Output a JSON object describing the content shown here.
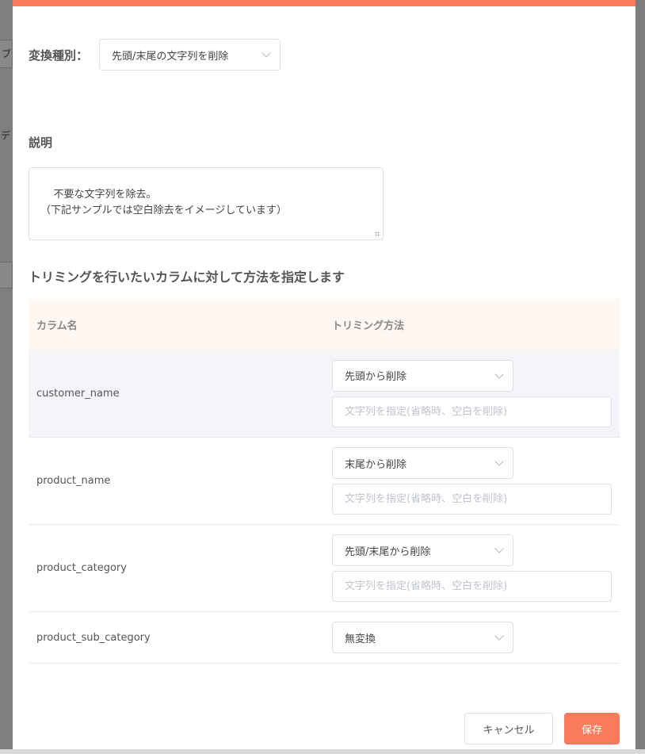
{
  "background": {
    "fragments": [
      "ブ",
      "デ"
    ]
  },
  "conversion": {
    "label": "変換種別：",
    "selected": "先頭/末尾の文字列を削除"
  },
  "description": {
    "title": "説明",
    "text": "不要な文字列を除去。\n（下記サンプルでは空白除去をイメージしています）"
  },
  "section_title": "トリミングを行いたいカラムに対して方法を指定します",
  "table": {
    "headers": [
      "カラム名",
      "トリミング方法"
    ],
    "rows": [
      {
        "name": "customer_name",
        "method": "先頭から削除",
        "placeholder": "文字列を指定(省略時、空白を削除)"
      },
      {
        "name": "product_name",
        "method": "末尾から削除",
        "placeholder": "文字列を指定(省略時、空白を削除)"
      },
      {
        "name": "product_category",
        "method": "先頭/末尾から削除",
        "placeholder": "文字列を指定(省略時、空白を削除)"
      },
      {
        "name": "product_sub_category",
        "method": "無変換"
      }
    ]
  },
  "buttons": {
    "cancel": "キャンセル",
    "save": "保存"
  },
  "colors": {
    "accent": "#f97b5e",
    "header_bg": "#fef7f2",
    "highlight_row": "#f3f5f9"
  }
}
